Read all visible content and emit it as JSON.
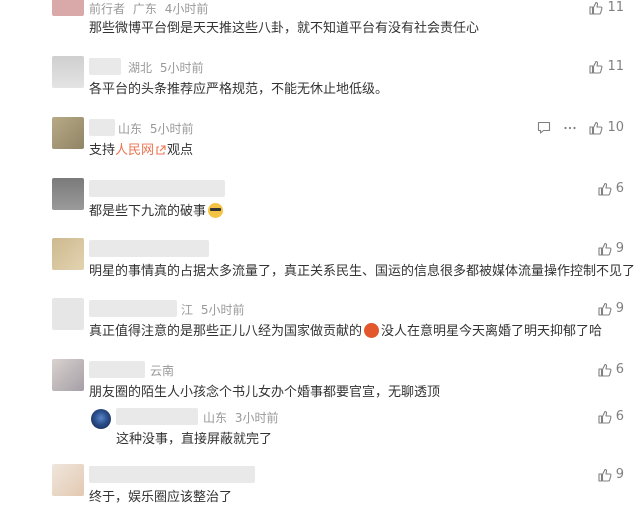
{
  "comments": [
    {
      "name": "前行者",
      "location": "广东",
      "time": "4小时前",
      "text": "那些微博平台倒是天天推这些八卦，就不知道平台有没有社会责任心",
      "likes": "11"
    },
    {
      "name": "",
      "location": "湖北",
      "time": "5小时前",
      "text": "各平台的头条推荐应严格规范，不能无休止地低级。",
      "likes": "11"
    },
    {
      "name": "",
      "location": "山东",
      "time": "5小时前",
      "text_before": "支持",
      "link": "人民网",
      "text_after": "观点",
      "likes": "10"
    },
    {
      "name": "",
      "text": "都是些下九流的破事",
      "likes": "6"
    },
    {
      "name": "",
      "text": "明星的事情真的占据太多流量了，真正关系民生、国运的信息很多都被媒体流量操作控制不见了",
      "likes": "9"
    },
    {
      "name": "江",
      "time": "5小时前",
      "text_before": "真正值得注意的是那些正儿八经为国家做贡献的",
      "text_after": "没人在意明星今天离婚了明天抑郁了哈",
      "likes": "9"
    },
    {
      "name": "",
      "location": "云南",
      "text": "朋友圈的陌生人小孩念个书儿女办个婚事都要官宣，无聊透顶",
      "likes": "6"
    },
    {
      "name": "",
      "location": "山东",
      "time": "3小时前",
      "text": "这种没事，直接屏蔽就完了",
      "likes": "6"
    },
    {
      "name": "",
      "text": "终于，娱乐圈应该整治了",
      "likes": "9"
    }
  ],
  "icons": {
    "like": "thumbs-up-icon",
    "comment": "comment-icon",
    "more": "more-dots-icon",
    "link": "link-icon"
  },
  "colors": {
    "link": "#eb7350",
    "meta": "#999999",
    "text": "#333333"
  }
}
